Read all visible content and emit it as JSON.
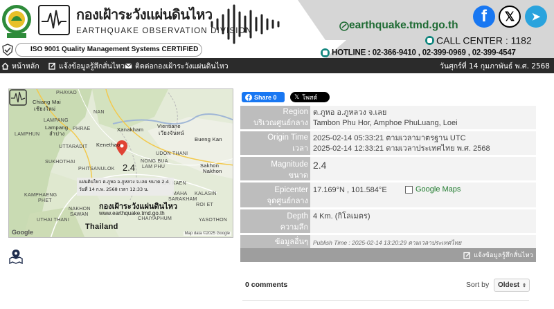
{
  "header": {
    "title_th": "กองเฝ้าระวังแผ่นดินไหว",
    "title_en": "EARTHQUAKE OBSERVATION DIVISION",
    "iso": "ISO 9001 Quality Management Systems CERTIFIED",
    "website": "earthquake.tmd.go.th",
    "call_center": "CALL CENTER : 1182",
    "hotline": "HOTLINE : 02-366-9410 , 02-399-0969 , 02-399-4547",
    "social": [
      {
        "icon": "facebook-icon",
        "glyph": "f"
      },
      {
        "icon": "x-icon",
        "glyph": "𝕏"
      },
      {
        "icon": "telegram-icon",
        "glyph": "➤"
      }
    ],
    "colors": {
      "accent_green": "#1e6b33",
      "navbar": "#2b2b2b"
    }
  },
  "nav": {
    "items": [
      {
        "label": "หน้าหลัก",
        "icon": "home-icon"
      },
      {
        "label": "แจ้งข้อมูลรู้สึกสั่นไหว",
        "icon": "edit-icon"
      },
      {
        "label": "ติดต่อกองเฝ้าระวังแผ่นดินไหว",
        "icon": "mail-icon"
      }
    ],
    "date": "วันศุกร์ที่ 14 กุมภาพันธ์ พ.ศ. 2568"
  },
  "map": {
    "magnitude": "2.4",
    "popup_line1": "แผ่นดินไหว ต.ภูหอ อ.ภูหลวง จ.เลย ขนาด 2.4",
    "popup_line2": "วันที่ 14 ก.พ. 2568 เวลา 12:33 น.",
    "watermark_title": "กองเฝ้าระวังแผ่นดินไหว",
    "watermark_url": "www.earthquake.tmd.go.th",
    "country": "Thailand",
    "google": "Google",
    "credit": "Map data ©2025 Google",
    "labels": [
      {
        "text": "PHAYAO",
        "cls": ""
      },
      {
        "text": "Chiang Mai",
        "cls": "city"
      },
      {
        "text": "เชียงใหม่",
        "cls": "city"
      },
      {
        "text": "LAMPANG",
        "cls": ""
      },
      {
        "text": "Lampang",
        "cls": "city"
      },
      {
        "text": "ลำปาง",
        "cls": "city"
      },
      {
        "text": "PHRAE",
        "cls": ""
      },
      {
        "text": "NAN",
        "cls": ""
      },
      {
        "text": "LAMPHUN",
        "cls": ""
      },
      {
        "text": "UTTARADIT",
        "cls": ""
      },
      {
        "text": "SUKHOTHAI",
        "cls": ""
      },
      {
        "text": "Xanakham",
        "cls": "city"
      },
      {
        "text": "Kenethao",
        "cls": "city"
      },
      {
        "text": "Vientiane",
        "cls": "city"
      },
      {
        "text": "เวียงจันทน์",
        "cls": "city"
      },
      {
        "text": "Bueng Kan",
        "cls": "city"
      },
      {
        "text": "UDON THANI",
        "cls": ""
      },
      {
        "text": "NONG BUA",
        "cls": ""
      },
      {
        "text": "LAM PHU",
        "cls": ""
      },
      {
        "text": "KHON KAEN",
        "cls": ""
      },
      {
        "text": "Sakhon",
        "cls": "city"
      },
      {
        "text": "Nakhon",
        "cls": "city"
      },
      {
        "text": "KALASIN",
        "cls": ""
      },
      {
        "text": "PHITSANULOK",
        "cls": ""
      },
      {
        "text": "KAMPHAENG",
        "cls": ""
      },
      {
        "text": "PHET",
        "cls": ""
      },
      {
        "text": "NAKHON",
        "cls": ""
      },
      {
        "text": "SAWAN",
        "cls": ""
      },
      {
        "text": "UTHAI THANI",
        "cls": ""
      },
      {
        "text": "MAHA",
        "cls": ""
      },
      {
        "text": "SARAKHAM",
        "cls": ""
      },
      {
        "text": "ROI ET",
        "cls": ""
      },
      {
        "text": "CHAIYAPHUM",
        "cls": ""
      },
      {
        "text": "YASOTHON",
        "cls": ""
      }
    ]
  },
  "share": {
    "fb_label": "Share 0",
    "x_label": "โพสต์"
  },
  "info": {
    "region_en": "Region",
    "region_th": "บริเวณศูนย์กลาง",
    "region_value_th": "ต.ภูหอ อ.ภูหลวง จ.เลย",
    "region_value_en": "Tambon Phu Hor, Amphoe PhuLuang, Loei",
    "origin_en": "Origin Time",
    "origin_th": "เวลา",
    "origin_utc": "2025-02-14 05:33:21 ตามเวลามาตรฐาน UTC",
    "origin_local": "2025-02-14 12:33:21 ตามเวลาประเทศไทย พ.ศ. 2568",
    "mag_en": "Magnitude",
    "mag_th": "ขนาด",
    "mag_value": "2.4",
    "epi_en": "Epicenter",
    "epi_th": "จุดศูนย์กลาง",
    "epi_value": "17.169°N , 101.584°E",
    "gmaps_label": "Google Maps",
    "depth_en": "Depth",
    "depth_th": "ความลึก",
    "depth_value": "4 Km. (กิโลเมตร)",
    "more_th": "ข้อมูลอื่นๆ",
    "publish": "Publish Time : 2025-02-14 13:20:29 ตามเวลาประเทศไทย",
    "report_link": "แจ้งข้อมูลรู้สึกสั่นไหว"
  },
  "comments": {
    "count": "0 comments",
    "sort_label": "Sort by",
    "sort_value": "Oldest"
  }
}
